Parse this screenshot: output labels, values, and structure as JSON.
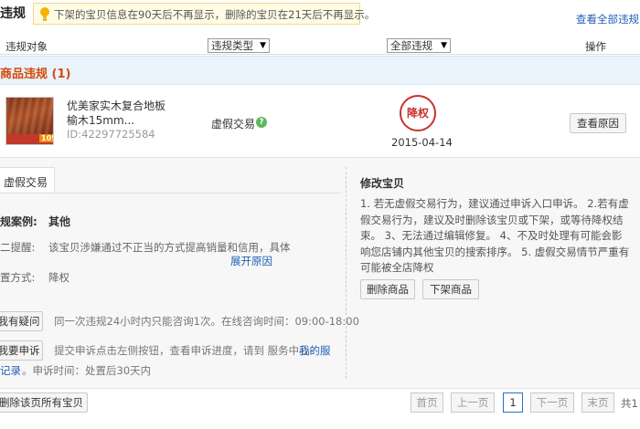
{
  "header": {
    "title": "违规",
    "notice": "下架的宝贝信息在90天后不再显示，删除的宝贝在21天后不再显示。",
    "view_all_link": "查看全部违规"
  },
  "table_header": {
    "col_object": "违规对象",
    "col_type_select": "违规类型",
    "col_status_select": "全部违规",
    "col_action": "操作"
  },
  "section": {
    "title": "商品违规 (1)"
  },
  "item": {
    "name_line1": "优美家实木复合地板",
    "name_line2": "榆木15mm...",
    "id": "ID:42297725584",
    "thumb_badge": "105",
    "violation_type": "虚假交易",
    "stamp": "降权",
    "date": "2015-04-14",
    "view_reason_button": "查看原因"
  },
  "detail": {
    "tab_label": "虚假交易",
    "case_label": "规案例:",
    "case_value": "其他",
    "reminder_label": "二提醒:",
    "reminder_text": "该宝贝涉嫌通过不正当的方式提高销量和信用，具体",
    "expand_link": "展开原因",
    "method_label": "置方式:",
    "method_value": "降权",
    "question_button": "我有疑问",
    "question_text": "同一次违规24小时内只能咨询1次。在线咨询时间：09:00-18:00",
    "appeal_button": "我要申诉",
    "appeal_text": "提交申诉点击左侧按钮，查看申诉进度，请到 服务中心-",
    "appeal_link": "我的服",
    "appeal_link2": "记录",
    "appeal_time": "。申诉时间：处置后30天内"
  },
  "fix": {
    "title": "修改宝贝",
    "text": "1. 若无虚假交易行为，建议通过申诉入口申诉。 2.若有虚假交易行为，建议及时删除该宝贝或下架，或等待降权结束。 3、无法通过编辑修复。 4、不及时处理有可能会影响您店铺内其他宝贝的搜索排序。 5. 虚假交易情节严重有可能被全店降权",
    "delete_button": "删除商品",
    "delist_button": "下架商品"
  },
  "footer": {
    "delete_all_button": "删除该页所有宝贝",
    "first": "首页",
    "prev": "上一页",
    "current": "1",
    "next": "下一页",
    "last": "末页",
    "total": "共1"
  }
}
